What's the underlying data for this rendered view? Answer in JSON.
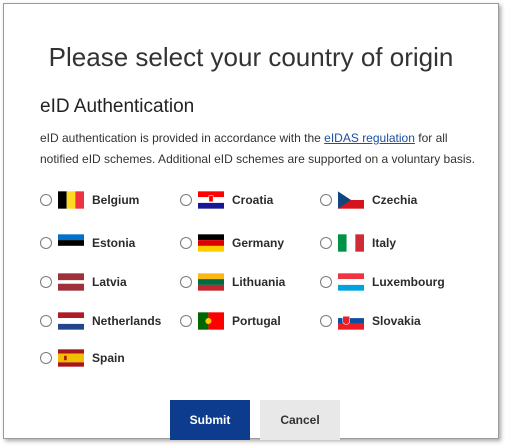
{
  "page": {
    "title": "Please select your country of origin",
    "subtitle": "eID Authentication",
    "desc_prefix": "eID authentication is provided in accordance with the ",
    "desc_link": "eIDAS regulation",
    "desc_suffix": " for all notified eID schemes. Additional eID schemes are supported on a voluntary basis."
  },
  "countries": [
    {
      "name": "Belgium",
      "flag": "flag-belgium-icon"
    },
    {
      "name": "Croatia",
      "flag": "flag-croatia-icon"
    },
    {
      "name": "Czechia",
      "flag": "flag-czechia-icon"
    },
    {
      "name": "Estonia",
      "flag": "flag-estonia-icon"
    },
    {
      "name": "Germany",
      "flag": "flag-germany-icon"
    },
    {
      "name": "Italy",
      "flag": "flag-italy-icon"
    },
    {
      "name": "Latvia",
      "flag": "flag-latvia-icon"
    },
    {
      "name": "Lithuania",
      "flag": "flag-lithuania-icon"
    },
    {
      "name": "Luxembourg",
      "flag": "flag-luxembourg-icon"
    },
    {
      "name": "Netherlands",
      "flag": "flag-netherlands-icon"
    },
    {
      "name": "Portugal",
      "flag": "flag-portugal-icon"
    },
    {
      "name": "Slovakia",
      "flag": "flag-slovakia-icon"
    },
    {
      "name": "Spain",
      "flag": "flag-spain-icon"
    }
  ],
  "buttons": {
    "submit": "Submit",
    "cancel": "Cancel"
  },
  "colors": {
    "submit_bg": "#0d3b8e",
    "cancel_bg": "#e8e8e8",
    "link": "#1a4fa3"
  }
}
